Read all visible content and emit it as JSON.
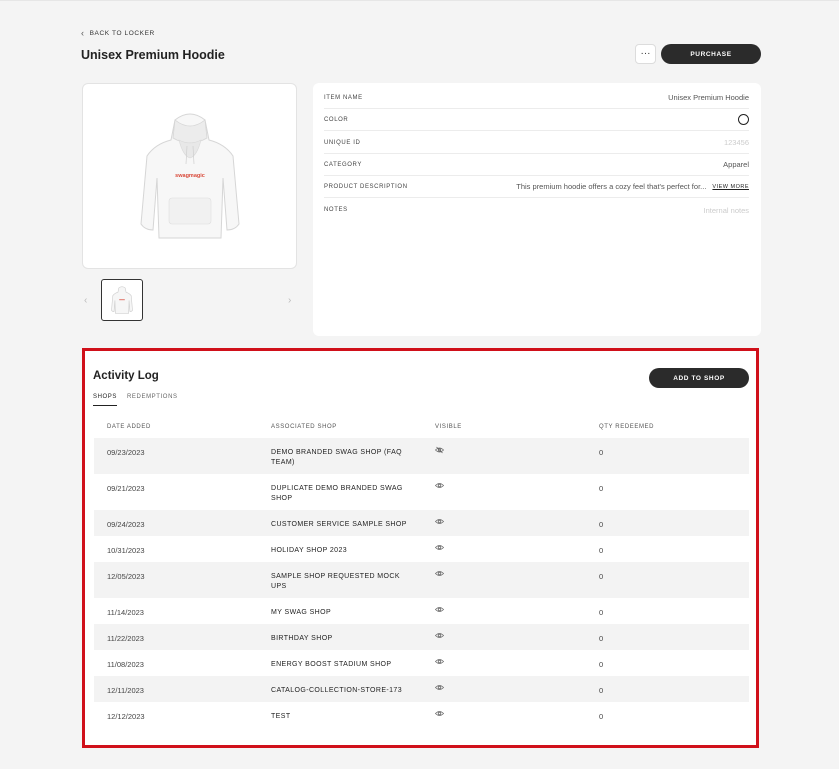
{
  "header": {
    "back_label": "BACK TO LOCKER",
    "title": "Unisex Premium Hoodie",
    "more_label": "···",
    "purchase_label": "PURCHASE"
  },
  "product_image": {
    "print_text": "swagmagic",
    "thumbnail_count": 1
  },
  "details": {
    "item_name_label": "ITEM NAME",
    "item_name": "Unisex Premium Hoodie",
    "color_label": "COLOR",
    "color_value": "#ffffff",
    "unique_id_label": "UNIQUE ID",
    "unique_id_placeholder": "123456",
    "category_label": "CATEGORY",
    "category": "Apparel",
    "description_label": "PRODUCT DESCRIPTION",
    "description": "This premium hoodie offers a cozy feel that's perfect for...",
    "view_more_label": "VIEW MORE",
    "notes_label": "NOTES",
    "notes_placeholder": "Internal notes"
  },
  "activity_log": {
    "title": "Activity Log",
    "add_to_shop_label": "ADD TO SHOP",
    "tabs": [
      {
        "label": "SHOPS",
        "active": true
      },
      {
        "label": "REDEMPTIONS",
        "active": false
      }
    ],
    "columns": {
      "date_added": "DATE ADDED",
      "associated_shop": "ASSOCIATED SHOP",
      "visible": "VISIBLE",
      "qty_redeemed": "QTY REDEEMED"
    },
    "rows": [
      {
        "date": "09/23/2023",
        "shop": "DEMO BRANDED SWAG SHOP (FAQ TEAM)",
        "visible": false,
        "qty": "0"
      },
      {
        "date": "09/21/2023",
        "shop": "DUPLICATE DEMO BRANDED SWAG SHOP",
        "visible": true,
        "qty": "0"
      },
      {
        "date": "09/24/2023",
        "shop": "CUSTOMER SERVICE SAMPLE SHOP",
        "visible": true,
        "qty": "0"
      },
      {
        "date": "10/31/2023",
        "shop": "HOLIDAY SHOP 2023",
        "visible": true,
        "qty": "0"
      },
      {
        "date": "12/05/2023",
        "shop": "SAMPLE SHOP REQUESTED MOCK UPS",
        "visible": true,
        "qty": "0"
      },
      {
        "date": "11/14/2023",
        "shop": "MY SWAG SHOP",
        "visible": true,
        "qty": "0"
      },
      {
        "date": "11/22/2023",
        "shop": "BIRTHDAY SHOP",
        "visible": true,
        "qty": "0"
      },
      {
        "date": "11/08/2023",
        "shop": "ENERGY BOOST STADIUM SHOP",
        "visible": true,
        "qty": "0"
      },
      {
        "date": "12/11/2023",
        "shop": "CATALOG-COLLECTION-STORE-173",
        "visible": true,
        "qty": "0"
      },
      {
        "date": "12/12/2023",
        "shop": "TEST",
        "visible": true,
        "qty": "0"
      }
    ]
  },
  "colors": {
    "accent_dark": "#2b2b2b",
    "highlight_border": "#d0101a",
    "hoodie_print": "#d94a3a"
  }
}
